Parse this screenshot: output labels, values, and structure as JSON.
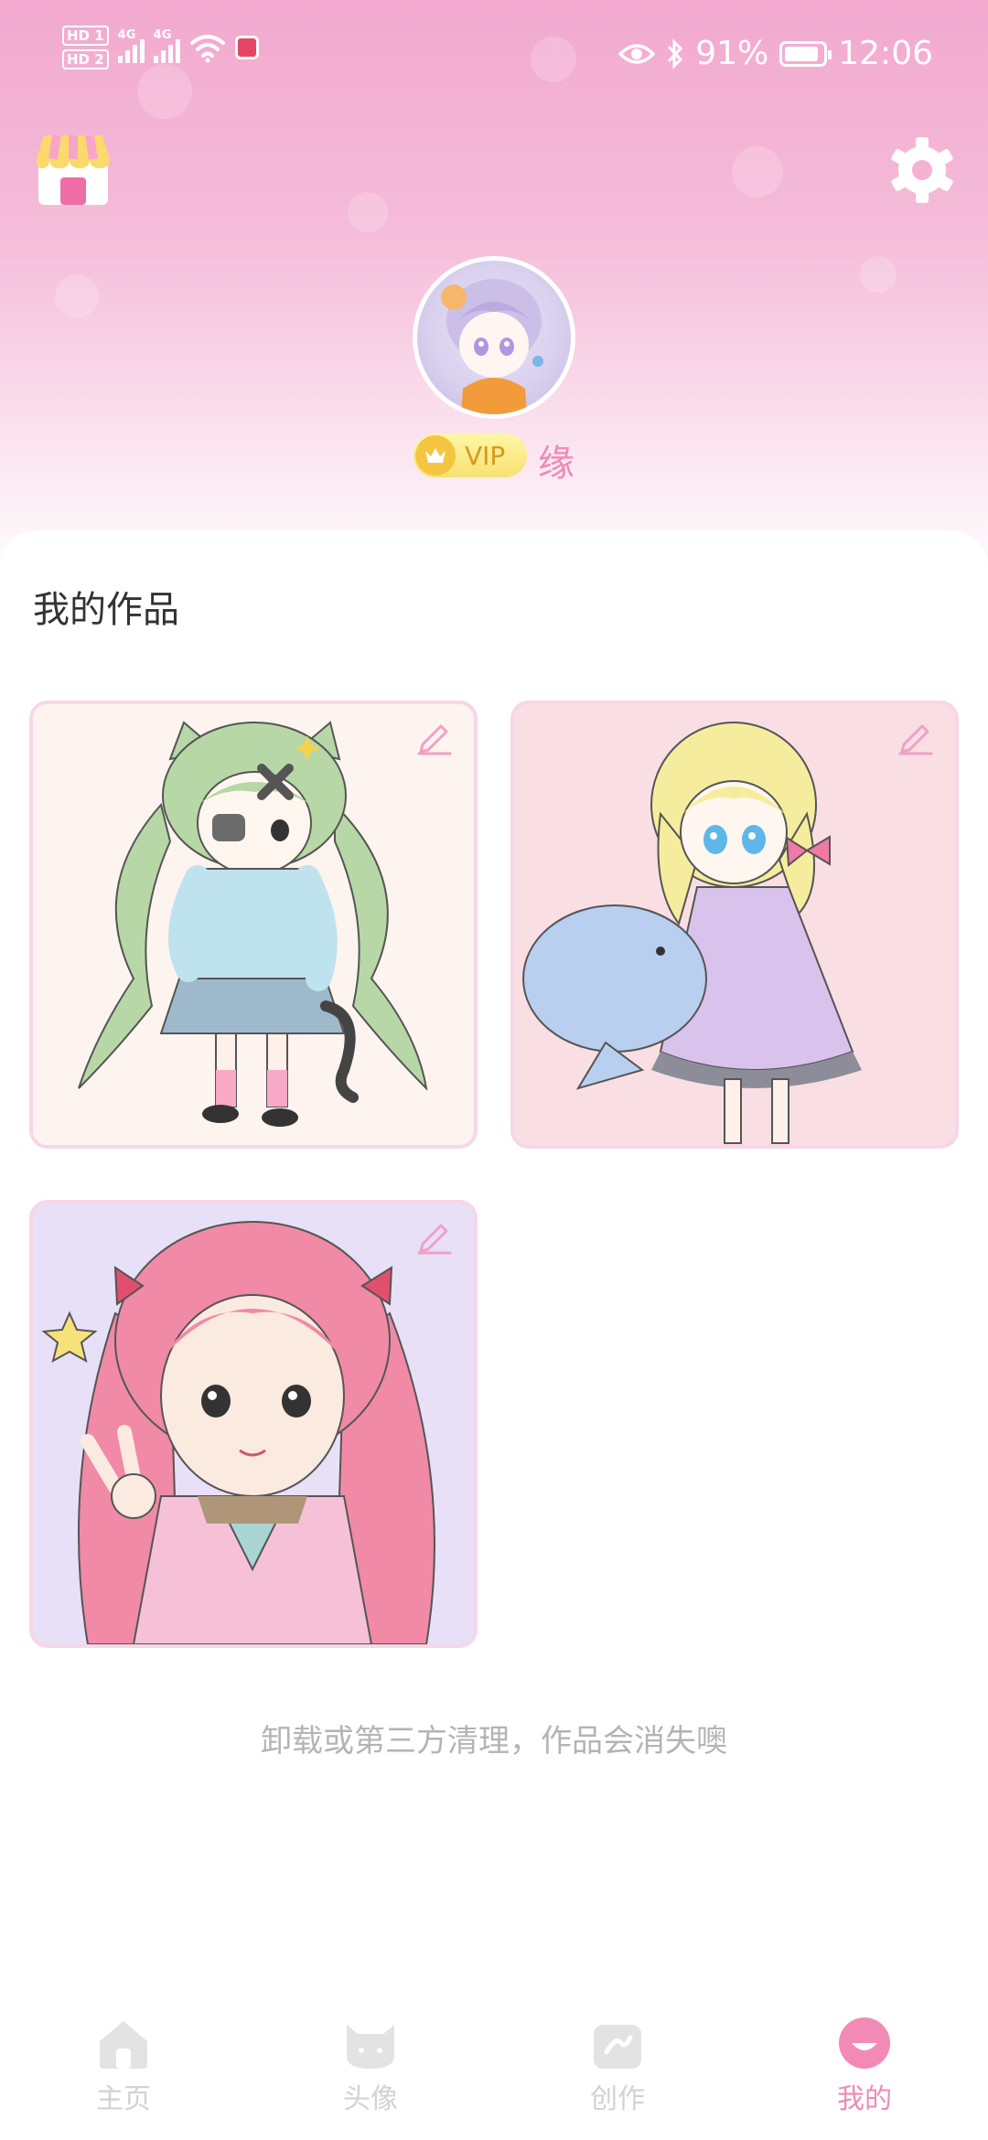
{
  "status_bar": {
    "hd1": "HD 1",
    "hd2": "HD 2",
    "net1": "4G",
    "net2": "4G",
    "battery_percent": "91%",
    "time": "12:06",
    "battery_level": 0.91
  },
  "header": {
    "shop_icon": "shop-icon",
    "settings_icon": "gear-icon"
  },
  "profile": {
    "vip_label": "VIP",
    "username": "缘"
  },
  "works": {
    "section_title": "我的作品",
    "items": [
      {
        "name": "green-hair-cat-girl",
        "bg": "#fdf4ef"
      },
      {
        "name": "blonde-girl-with-whale",
        "bg": "#f9dfe3"
      },
      {
        "name": "pink-twin-tail-girl",
        "bg": "#e8e0f7"
      }
    ],
    "hint": "卸载或第三方清理，作品会消失噢"
  },
  "tabbar": {
    "tabs": [
      {
        "label": "主页",
        "icon": "home-icon",
        "active": false
      },
      {
        "label": "头像",
        "icon": "cat-face-icon",
        "active": false
      },
      {
        "label": "创作",
        "icon": "create-icon",
        "active": false
      },
      {
        "label": "我的",
        "icon": "profile-icon",
        "active": true
      }
    ]
  },
  "colors": {
    "accent": "#ee8ab7",
    "header_top": "#f2a9cf",
    "card_border": "#f7d6e8",
    "hint": "#b4b4b4"
  }
}
